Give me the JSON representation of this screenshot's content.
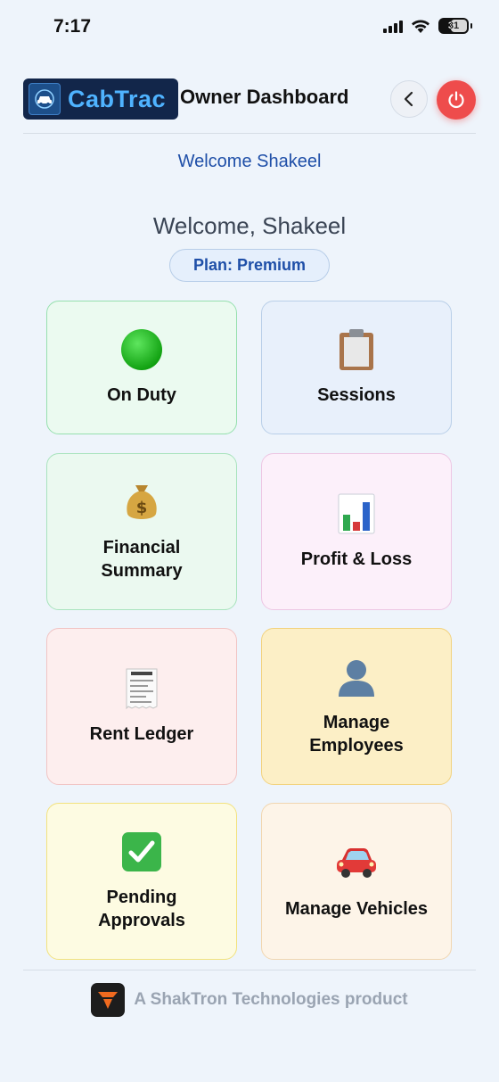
{
  "status_bar": {
    "time": "7:17",
    "battery": "31"
  },
  "header": {
    "logo_text": "CabTrac",
    "title": "Owner Dashboard",
    "back_icon": "chevron-left-icon",
    "power_icon": "power-icon",
    "power_color": "#ee4c4c"
  },
  "welcome_link": "Welcome Shakeel",
  "welcome_heading": "Welcome, Shakeel",
  "plan_badge": "Plan: Premium",
  "tiles": [
    {
      "label": "On Duty",
      "icon": "green-circle-icon",
      "color": "#ebfaf0"
    },
    {
      "label": "Sessions",
      "icon": "clipboard-icon",
      "color": "#e8f0fb"
    },
    {
      "label": "Financial Summary",
      "icon": "money-bag-icon",
      "color": "#ebf9f0"
    },
    {
      "label": "Profit & Loss",
      "icon": "bar-chart-icon",
      "color": "#fcf0fa"
    },
    {
      "label": "Rent Ledger",
      "icon": "receipt-icon",
      "color": "#fdeeee"
    },
    {
      "label": "Manage Employees",
      "icon": "user-silhouette-icon",
      "color": "#fcefc6"
    },
    {
      "label": "Pending Approvals",
      "icon": "check-mark-button-icon",
      "color": "#fdfbe2"
    },
    {
      "label": "Manage Vehicles",
      "icon": "car-icon",
      "color": "#fdf4e8"
    }
  ],
  "footer": {
    "text": "A ShakTron Technologies product"
  }
}
